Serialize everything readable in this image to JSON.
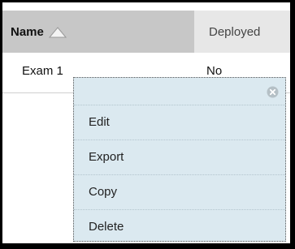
{
  "table": {
    "columns": {
      "name_label": "Name",
      "deployed_label": "Deployed",
      "sort_icon": "sort-ascending-triangle-icon"
    },
    "rows": [
      {
        "name": "Exam 1",
        "deployed": "No"
      }
    ]
  },
  "context_menu": {
    "close_icon": "close-circle-icon",
    "items": [
      {
        "label": "Edit"
      },
      {
        "label": "Export"
      },
      {
        "label": "Copy"
      },
      {
        "label": "Delete"
      }
    ]
  },
  "colors": {
    "header_active_bg": "#c7c7c7",
    "header_bg": "#e7e7e7",
    "menu_bg": "#dbe9f0",
    "frame_border": "#000000"
  }
}
